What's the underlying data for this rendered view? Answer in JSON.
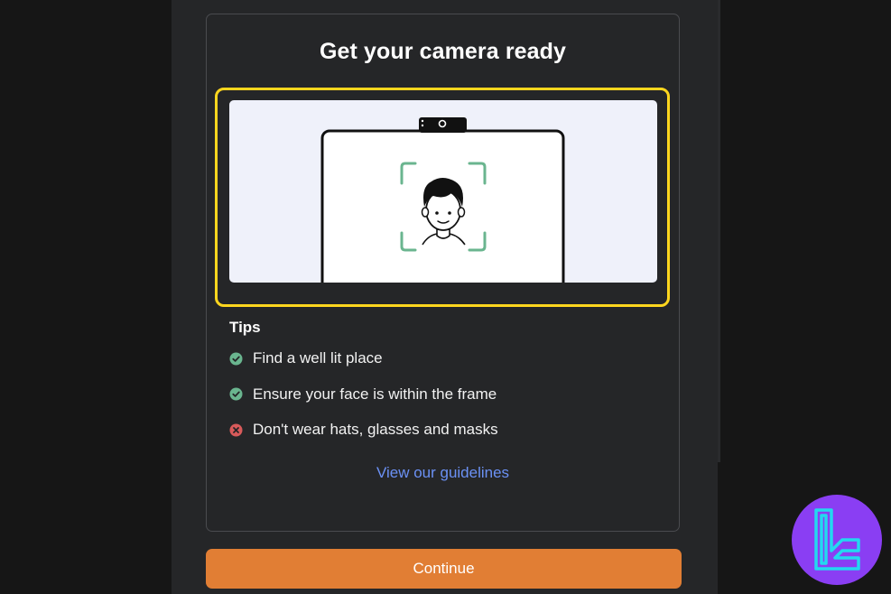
{
  "card": {
    "title": "Get your camera ready"
  },
  "illustration": {
    "icon": "camera-face-frame-illustration"
  },
  "tips": {
    "heading": "Tips",
    "items": [
      {
        "text": "Find a well lit place",
        "status": "do",
        "icon": "check-circle-icon"
      },
      {
        "text": "Ensure your face is within the frame",
        "status": "do",
        "icon": "check-circle-icon"
      },
      {
        "text": "Don't wear hats, glasses and masks",
        "status": "dont",
        "icon": "cross-circle-icon"
      }
    ]
  },
  "guidelines_link": "View our guidelines",
  "continue_label": "Continue",
  "colors": {
    "accent": "#e17e34",
    "link": "#6b91f5",
    "highlight": "#ffd61e",
    "success": "#6ab58f",
    "error": "#d85a5a",
    "logo_bg": "#8a3ef3",
    "logo_fg": "#23d8f0"
  }
}
